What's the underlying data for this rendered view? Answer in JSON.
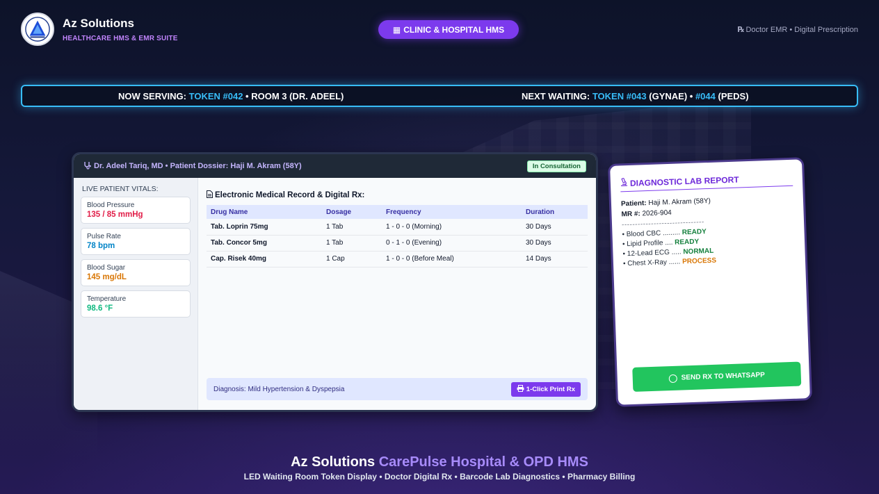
{
  "brand": {
    "name": "Az Solutions",
    "tagline": "HEALTHCARE HMS & EMR SUITE"
  },
  "header_pill": {
    "icon": "hospital-icon",
    "label": "CLINIC & HOSPITAL HMS"
  },
  "top_right": {
    "icon": "rx-icon",
    "text": "Doctor EMR • Digital Prescription"
  },
  "token_display": {
    "now_label": "NOW SERVING:",
    "now_token": "TOKEN #042",
    "now_room": "• ROOM 3 (DR. ADEEL)",
    "next_label": "NEXT WAITING:",
    "next_token1": "TOKEN #043",
    "next_dept1": "(GYNAE) •",
    "next_token2": "#044",
    "next_dept2": "(PEDS)"
  },
  "emr": {
    "header": "Dr. Adeel Tariq, MD • Patient Dossier: Haji M. Akram (58Y)",
    "status_badge": "In Consultation",
    "vitals_title": "LIVE PATIENT VITALS:",
    "vitals": [
      {
        "label": "Blood Pressure",
        "value": "135 / 85 mmHg",
        "color": "#e11d48"
      },
      {
        "label": "Pulse Rate",
        "value": "78 bpm",
        "color": "#0284c7"
      },
      {
        "label": "Blood Sugar",
        "value": "145 mg/dL",
        "color": "#d97706"
      },
      {
        "label": "Temperature",
        "value": "98.6 °F",
        "color": "#10b981"
      }
    ],
    "rx_title": "Electronic Medical Record & Digital Rx:",
    "rx_columns": [
      "Drug Name",
      "Dosage",
      "Frequency",
      "Duration"
    ],
    "rx_rows": [
      [
        "Tab. Loprin 75mg",
        "1 Tab",
        "1 - 0 - 0 (Morning)",
        "30 Days"
      ],
      [
        "Tab. Concor 5mg",
        "1 Tab",
        "0 - 1 - 0 (Evening)",
        "30 Days"
      ],
      [
        "Cap. Risek 40mg",
        "1 Cap",
        "1 - 0 - 0 (Before Meal)",
        "14 Days"
      ]
    ],
    "diagnosis": "Diagnosis: Mild Hypertension & Dyspepsia",
    "print_label": "1-Click Print Rx"
  },
  "lab": {
    "title": "DIAGNOSTIC LAB REPORT",
    "patient_label": "Patient:",
    "patient_value": "Haji M. Akram (58Y)",
    "mr_label": "MR #:",
    "mr_value": "2026-904",
    "divider": "-------------------------------",
    "items": [
      {
        "test": "• Blood CBC .........",
        "status": "READY",
        "color": "#15803d"
      },
      {
        "test": "• Lipid Profile ....",
        "status": "READY",
        "color": "#15803d"
      },
      {
        "test": "• 12-Lead ECG .....",
        "status": "NORMAL",
        "color": "#15803d"
      },
      {
        "test": "• Chest X-Ray ......",
        "status": "PROCESS",
        "color": "#d97706"
      }
    ],
    "whatsapp_label": "SEND RX TO WHATSAPP"
  },
  "footer": {
    "title_main": "Az Solutions",
    "title_accent": "CarePulse Hospital & OPD HMS",
    "subtitle": "LED Waiting Room Token Display • Doctor Digital Rx • Barcode Lab Diagnostics • Pharmacy Billing"
  }
}
